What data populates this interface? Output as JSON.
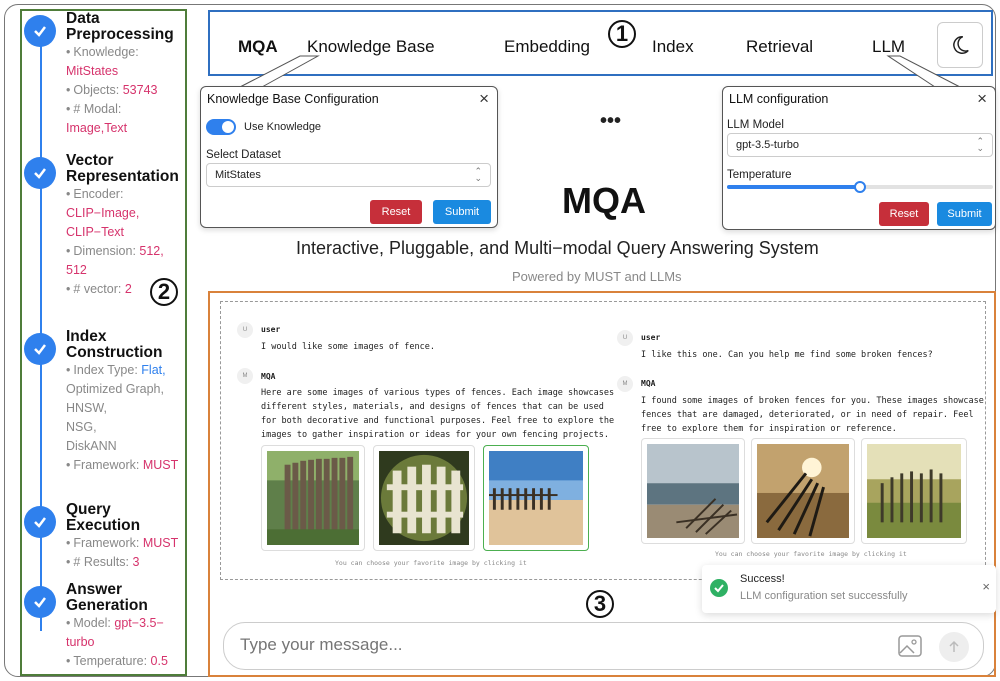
{
  "sidebar": {
    "steps": [
      {
        "title": "Data Preprocessing",
        "items": [
          {
            "label": "Knowledge:",
            "value": "MitStates"
          },
          {
            "label": "Objects:",
            "value": "53743"
          },
          {
            "label": "# Modal:",
            "value": "Image,Text"
          }
        ]
      },
      {
        "title": "Vector Representation",
        "items": [
          {
            "label": "Encoder:",
            "value": "CLIP−Image,"
          },
          {
            "label": "",
            "value": "CLIP−Text"
          },
          {
            "label": "Dimension:",
            "value": "512,"
          },
          {
            "label": "",
            "value": "512"
          },
          {
            "label": "# vector:",
            "value": "2"
          }
        ]
      },
      {
        "title": "Index Construction",
        "items": [
          {
            "label": "Index Type:",
            "value": "Flat,"
          },
          {
            "label": "",
            "value": "Optimized Graph,"
          },
          {
            "label": "",
            "value": "HNSW,"
          },
          {
            "label": "",
            "value": "NSG,"
          },
          {
            "label": "",
            "value": "DiskANN"
          },
          {
            "label": "Framework:",
            "value": "MUST"
          }
        ]
      },
      {
        "title": "Query Execution",
        "items": [
          {
            "label": "Framework:",
            "value": "MUST"
          },
          {
            "label": "# Results:",
            "value": "3"
          }
        ]
      },
      {
        "title": "Answer Generation",
        "items": [
          {
            "label": "Model:",
            "value": "gpt−3.5−"
          },
          {
            "label": "",
            "value": "turbo"
          },
          {
            "label": "Temperature:",
            "value": "0.5"
          }
        ]
      }
    ]
  },
  "annotations": {
    "one": "1",
    "two": "2",
    "three": "3"
  },
  "nav": {
    "brand": "MQA",
    "items": [
      "Knowledge Base",
      "Embedding",
      "Index",
      "Retrieval",
      "LLM"
    ],
    "theme_icon": "moon-icon"
  },
  "kb_modal": {
    "title": "Knowledge Base Configuration",
    "toggle_label": "Use Knowledge",
    "toggle_on": true,
    "select_label": "Select Dataset",
    "select_value": "MitStates",
    "reset": "Reset",
    "submit": "Submit"
  },
  "llm_modal": {
    "title": "LLM configuration",
    "model_label": "LLM Model",
    "model_value": "gpt-3.5-turbo",
    "temp_label": "Temperature",
    "temp_fraction": 0.5,
    "reset": "Reset",
    "submit": "Submit"
  },
  "ellipsis": "•••",
  "hero": {
    "title": "MQA",
    "subtitle": "Interactive, Pluggable, and Multi−modal Query Answering System",
    "powered": "Powered by MUST and LLMs"
  },
  "chat_left": {
    "user_avatar": "U",
    "user_name": "user",
    "user_text": "I would like some images of fence.",
    "bot_avatar": "M",
    "bot_name": "MQA",
    "bot_lines": [
      "Here are some images of various types of fences. Each image showcases",
      "different styles, materials, and designs of fences that can be used",
      "for both decorative and functional purposes. Feel free to explore the",
      "images to gather inspiration or ideas for your own fencing projects."
    ],
    "caption": "You can choose your favorite image by clicking it"
  },
  "chat_right": {
    "user_avatar": "U",
    "user_name": "user",
    "user_text": "I like this one. Can you help me find some broken fences?",
    "bot_avatar": "M",
    "bot_name": "MQA",
    "bot_lines": [
      "I found some images of broken fences for you. These images showcase",
      "fences that are damaged, deteriorated, or in need of repair. Feel",
      "free to explore them for inspiration or reference."
    ],
    "caption": "You can choose your favorite image by clicking it"
  },
  "toast": {
    "title": "Success!",
    "message": "LLM configuration set successfully"
  },
  "input": {
    "placeholder": "Type your message..."
  }
}
